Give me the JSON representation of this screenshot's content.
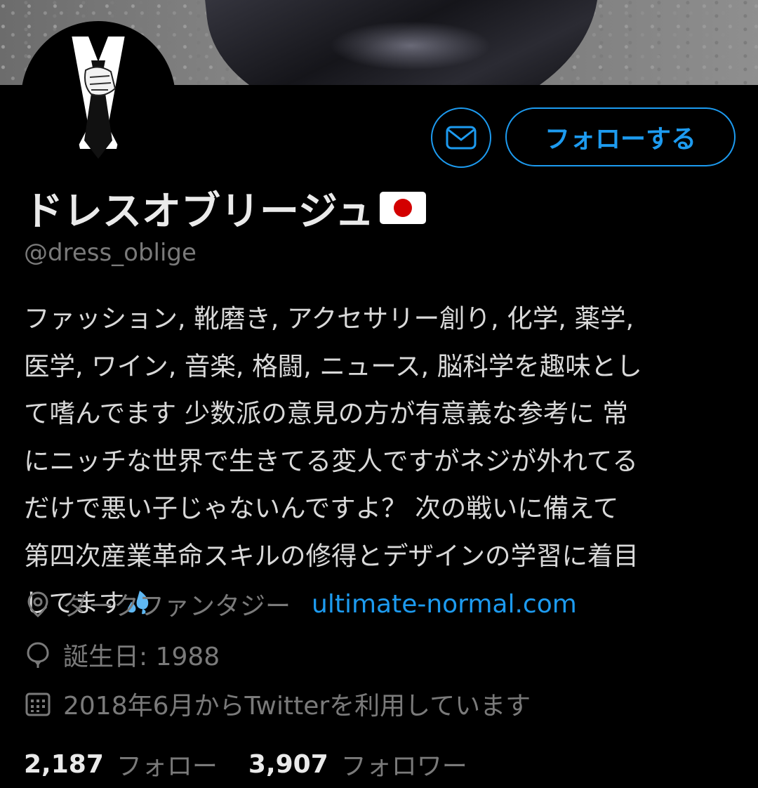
{
  "profile": {
    "display_name": "ドレスオブリージュ",
    "flag_icon": "japan-flag-icon",
    "handle": "@dress_oblige",
    "bio_lines": [
      "ファッション, 靴磨き, アクセサリー創り, 化学, 薬学,",
      "医学, ワイン, 音楽, 格闘, ニュース, 脳科学を趣味とし",
      "て嗜んでます 少数派の意見の方が有意義な参考に 常",
      "にニッチな世界で生きてる変人ですがネジが外れてる",
      "だけで悪い子じゃないんですよ？ 次の戦いに備えて",
      "第四次産業革命スキルの修得とデザインの学習に着目",
      "してます"
    ],
    "bio_emoji": "sweat-droplets-icon",
    "location": "ダークファンタジー",
    "website": "ultimate-normal.com",
    "birthday": "誕生日: 1988",
    "joined": "2018年6月からTwitterを利用しています"
  },
  "actions": {
    "message_icon": "envelope-icon",
    "follow_label": "フォローする"
  },
  "stats": {
    "following_count": "2,187",
    "following_label": "フォロー",
    "followers_count": "3,907",
    "followers_label": "フォロワー"
  },
  "colors": {
    "accent": "#1d9bf0",
    "background": "#000000",
    "muted_text": "#7a7a7a"
  }
}
